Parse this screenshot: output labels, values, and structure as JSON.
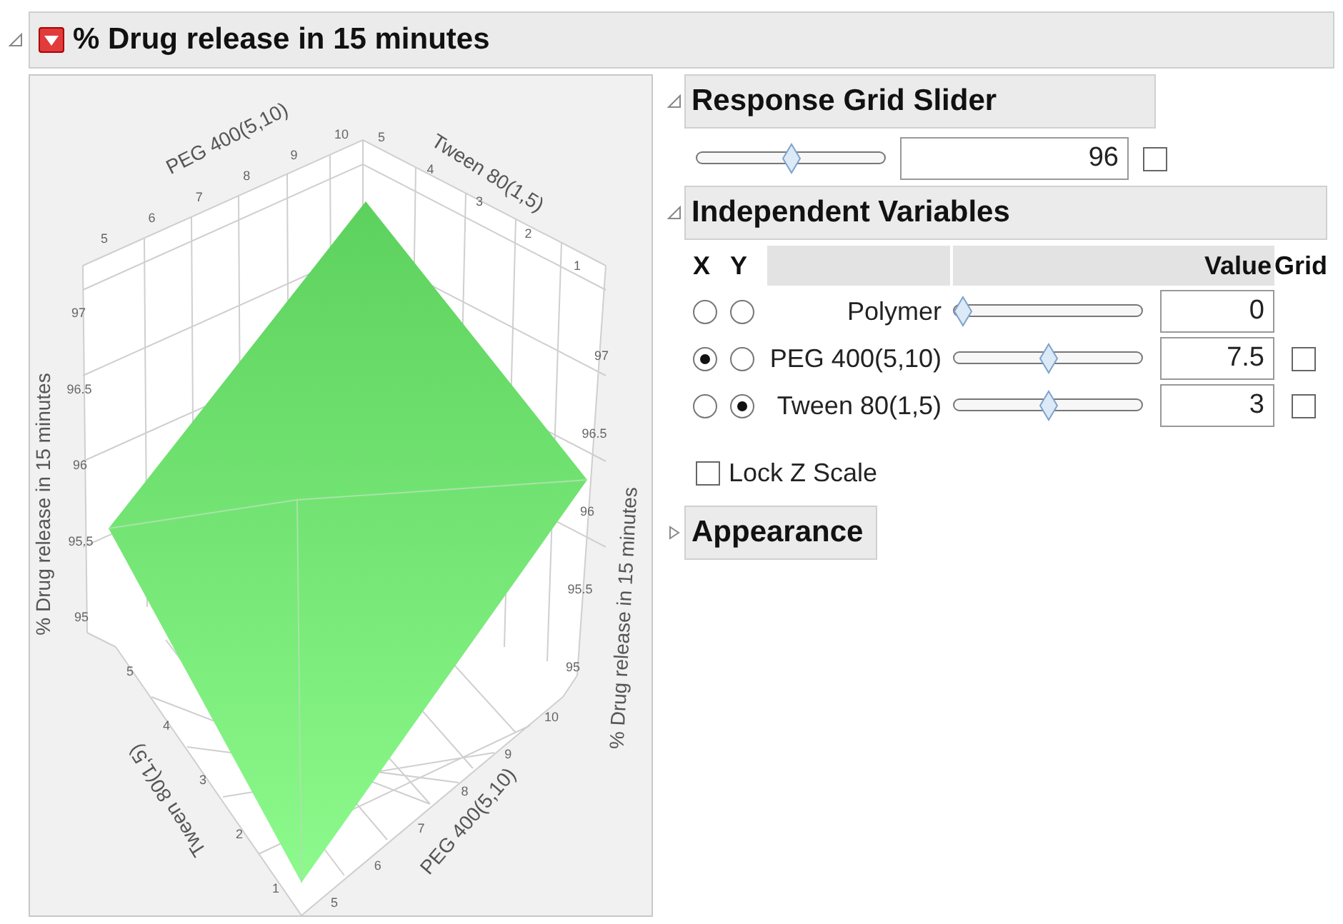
{
  "outline": {
    "title": "% Drug release in 15 minutes",
    "expanded": true
  },
  "plot": {
    "axes": [
      {
        "kind": "topleft",
        "label": "PEG 400(5,10)",
        "ticks": [
          "5",
          "6",
          "7",
          "8",
          "9",
          "10"
        ]
      },
      {
        "kind": "topright",
        "label": "Tween 80(1,5)",
        "ticks": [
          "5",
          "4",
          "3",
          "2",
          "1"
        ]
      },
      {
        "kind": "left",
        "label": "% Drug release in 15 minutes",
        "ticks": [
          "97",
          "96.5",
          "96",
          "95.5",
          "95"
        ]
      },
      {
        "kind": "right",
        "label": "% Drug release in 15 minutes",
        "ticks": [
          "97",
          "96.5",
          "96",
          "95.5",
          "95"
        ]
      },
      {
        "kind": "bottomright",
        "label": "PEG 400(5,10)",
        "ticks": [
          "5",
          "6",
          "7",
          "8",
          "9",
          "10"
        ]
      },
      {
        "kind": "bottomleft",
        "label": "Tween 80(1,5)",
        "ticks": [
          "5",
          "4",
          "3",
          "2",
          "1"
        ]
      }
    ]
  },
  "response_grid_slider": {
    "title": "Response Grid Slider",
    "expanded": true,
    "level": 0.5,
    "value": "96",
    "grid_checked": false
  },
  "independent_variables": {
    "title": "Independent Variables",
    "expanded": true,
    "columns": [
      "X",
      "Y",
      "Value",
      "Grid"
    ],
    "rows": [
      {
        "name": "Polymer",
        "x_selected": false,
        "y_selected": false,
        "level": 0,
        "value": "0"
      },
      {
        "name": "PEG 400(5,10)",
        "x_selected": true,
        "y_selected": false,
        "level": 0.5,
        "value": "7.5",
        "grid_checked": false
      },
      {
        "name": "Tween 80(1,5)",
        "x_selected": false,
        "y_selected": true,
        "level": 0.5,
        "value": "3",
        "grid_checked": false
      }
    ]
  },
  "lock_z_scale": {
    "label": "Lock Z Scale",
    "checked": false
  },
  "appearance": {
    "title": "Appearance",
    "expanded": false
  }
}
